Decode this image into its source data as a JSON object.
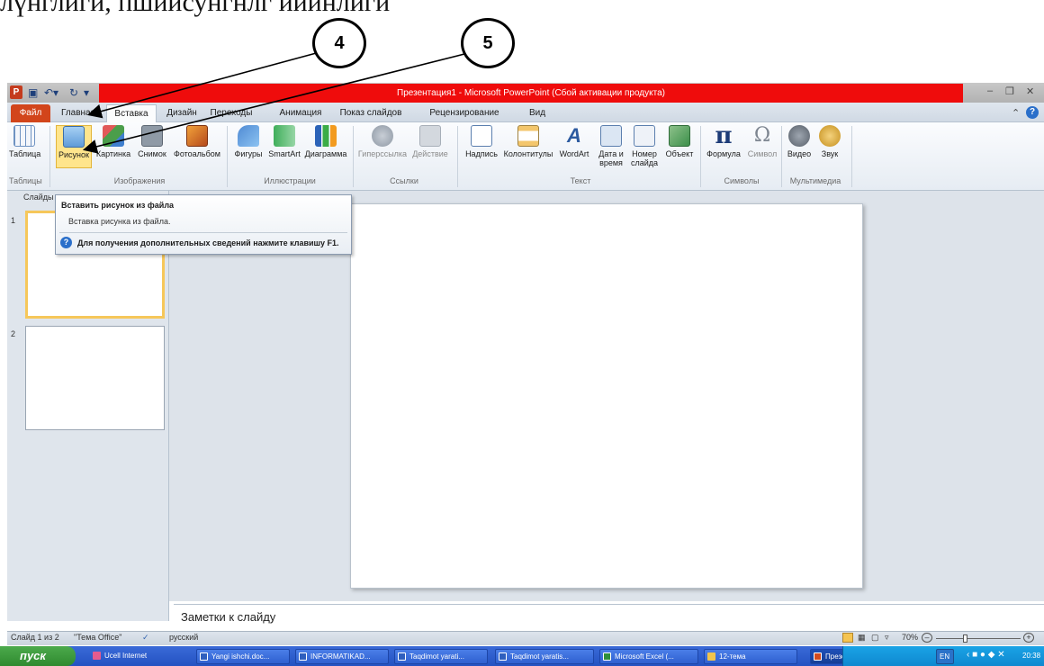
{
  "document_text_top": "лүнглиги, пшийсунгнлг иийнлиги",
  "callouts": {
    "c4": "4",
    "c5": "5"
  },
  "window": {
    "title": "Презентация1 - Microsoft PowerPoint (Сбой активации продукта)",
    "app_icon_letter": "P"
  },
  "tabs": [
    "Файл",
    "Главная",
    "Вставка",
    "Дизайн",
    "Переходы",
    "Анимация",
    "Показ слайдов",
    "Рецензирование",
    "Вид"
  ],
  "ribbon": {
    "buttons": {
      "table": "Таблица",
      "picture": "Рисунок",
      "clipart": "Картинка",
      "screenshot": "Снимок",
      "album": "Фотоальбом",
      "shapes": "Фигуры",
      "smartart": "SmartArt",
      "chart": "Диаграмма",
      "hyperlink": "Гиперссылка",
      "action": "Действие",
      "textbox": "Надпись",
      "header": "Колонтитулы",
      "wordart": "WordArt",
      "datetime_1": "Дата и",
      "datetime_2": "время",
      "slidenum_1": "Номер",
      "slidenum_2": "слайда",
      "object": "Объект",
      "equation": "Формула",
      "symbol": "Символ",
      "video": "Видео",
      "audio": "Звук"
    },
    "groups": {
      "tables": "Таблицы",
      "images": "Изображения",
      "illustrations": "Иллюстрации",
      "links": "Ссылки",
      "text": "Текст",
      "symbols": "Символы",
      "media": "Мультимедиа"
    },
    "glyphs": {
      "equation": "π",
      "symbol": "Ω",
      "wordart": "A"
    }
  },
  "tooltip": {
    "title": "Вставить рисунок из файла",
    "description": "Вставка рисунка из файла.",
    "help": "Для получения дополнительных сведений нажмите клавишу F1.",
    "help_icon": "?"
  },
  "slides_pane": {
    "tab_label": "Слайды",
    "thumbs": [
      "1",
      "2"
    ]
  },
  "notes_placeholder": "Заметки к слайду",
  "status": {
    "slide_info": "Слайд 1 из 2",
    "theme": "\"Тема Office\"",
    "language": "русский",
    "zoom": "70%"
  },
  "taskbar": {
    "start": "пуск",
    "items": [
      "Ucell Internet",
      "Yangi ishchi.doc...",
      "INFORMATIKAD...",
      "Taqdimot yarati...",
      "Taqdimot yaratis...",
      "Microsoft Excel (...",
      "12-тема",
      "Презентация1 -..."
    ],
    "lang": "EN",
    "clock": "20:38"
  },
  "colors": {
    "title_red": "#ef0c0c",
    "file_tab": "#d2451b",
    "highlight": "#ffe58c"
  }
}
